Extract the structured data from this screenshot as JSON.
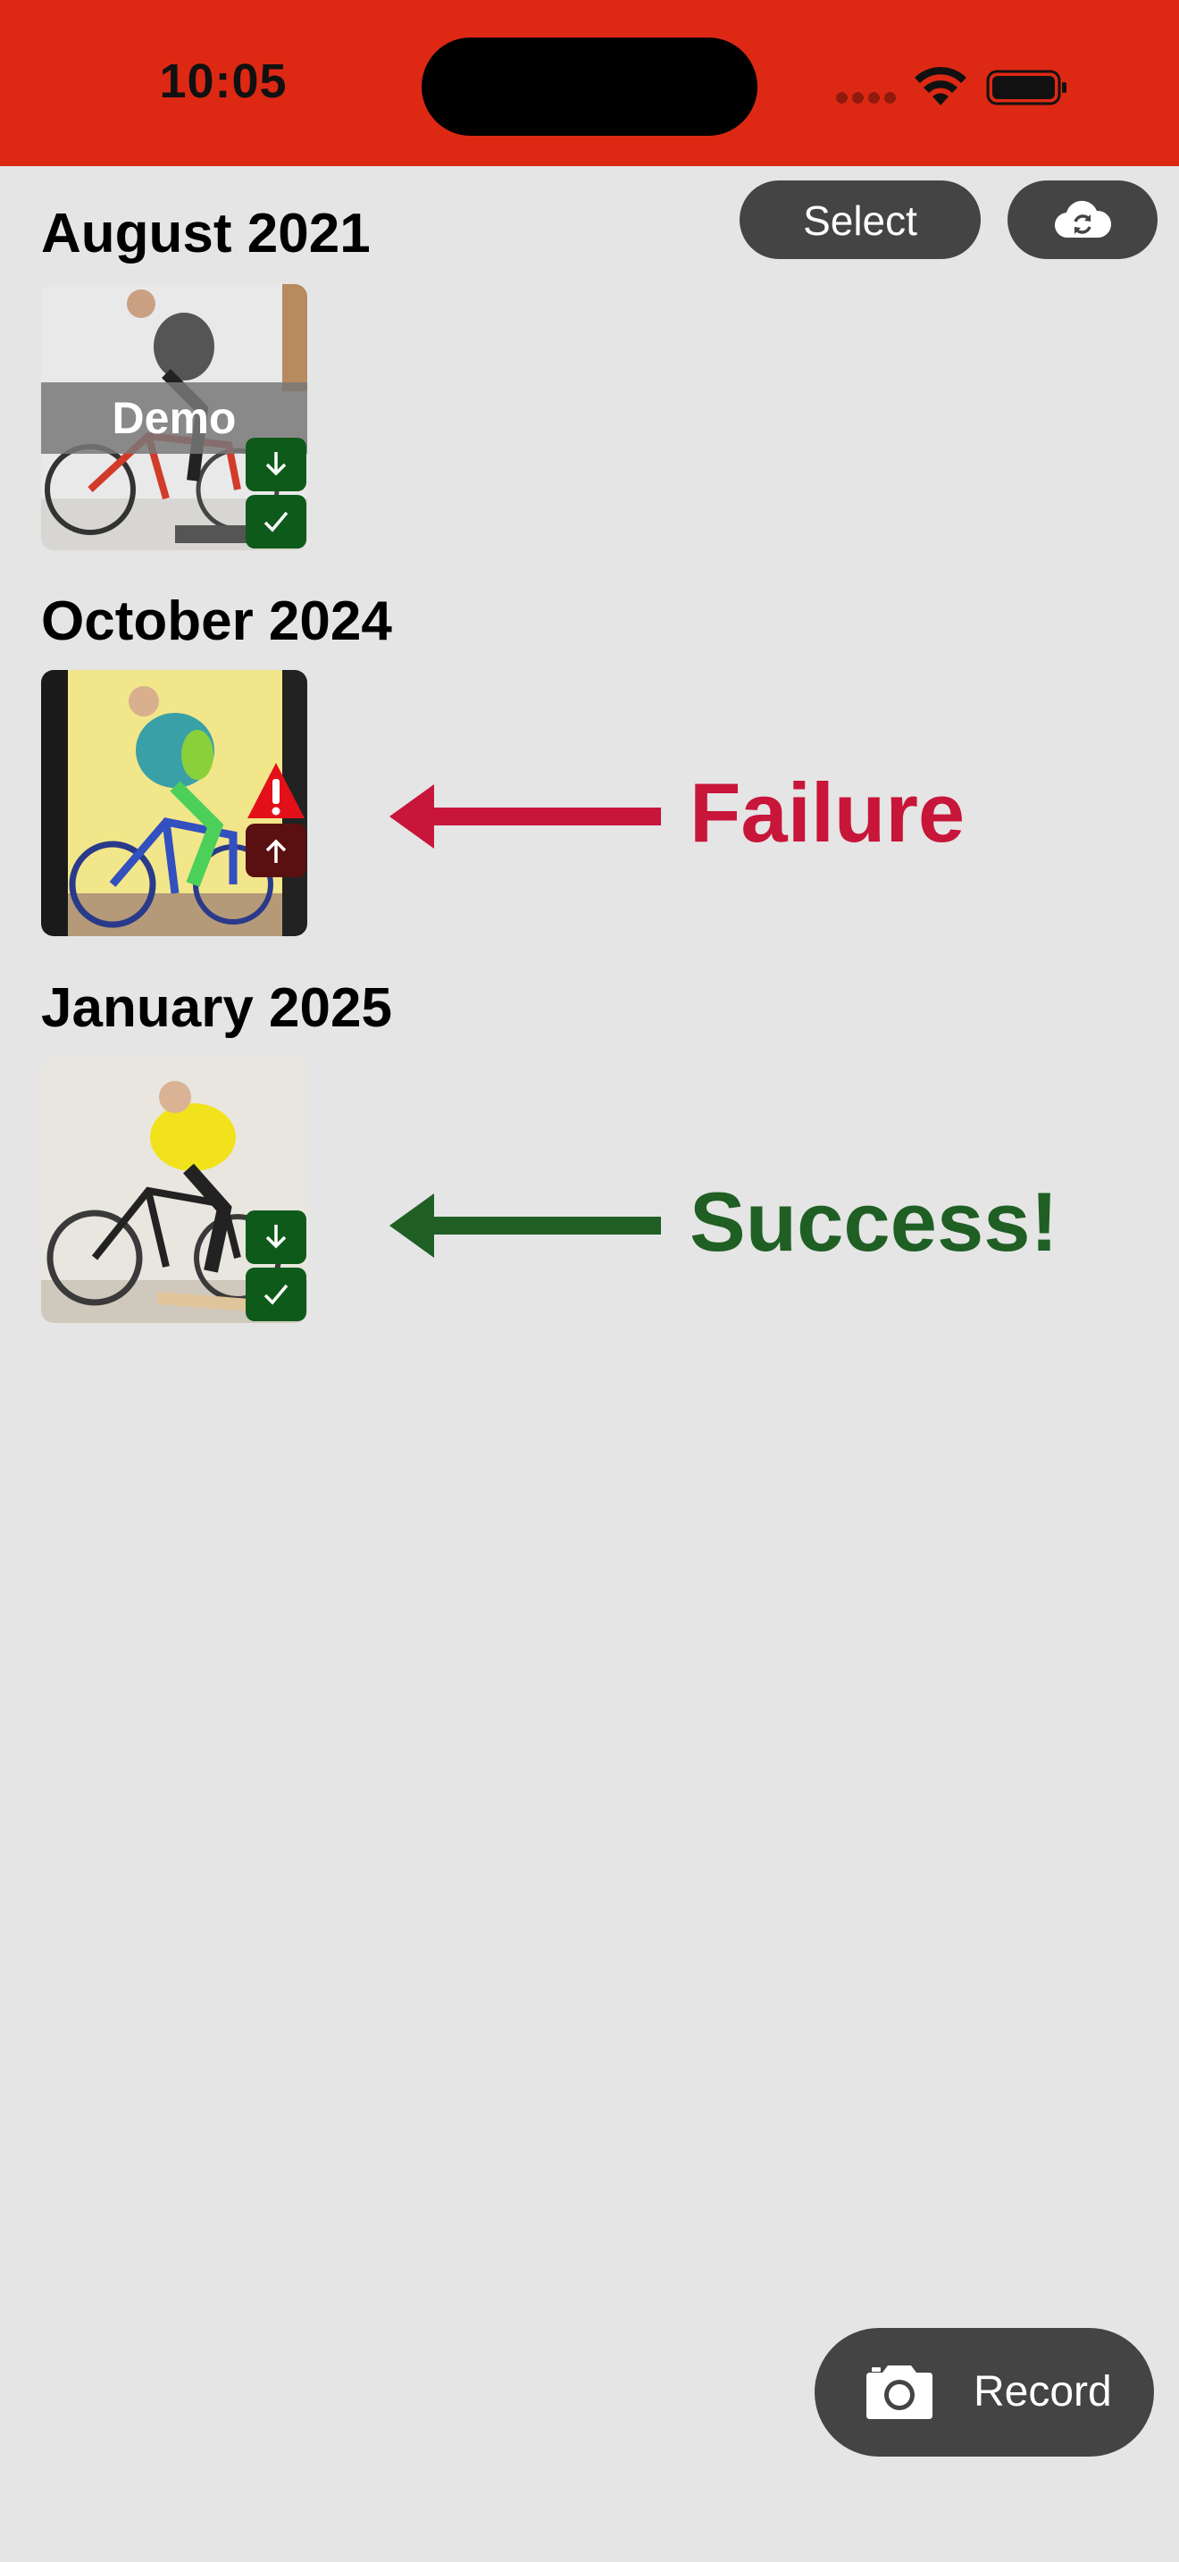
{
  "status_bar": {
    "time": "10:05",
    "background": "#dd2914"
  },
  "header": {
    "select_label": "Select",
    "cloud_sync_icon": "cloud-sync-icon"
  },
  "sections": [
    {
      "title": "August 2021",
      "videos": [
        {
          "overlay_label": "Demo",
          "badges": [
            "download-icon",
            "checkmark-icon"
          ]
        }
      ]
    },
    {
      "title": "October 2024",
      "videos": [
        {
          "badges": [
            "warning-icon",
            "upload-icon"
          ]
        }
      ]
    },
    {
      "title": "January 2025",
      "videos": [
        {
          "badges": [
            "download-icon",
            "checkmark-icon"
          ]
        }
      ]
    }
  ],
  "annotations": {
    "failure": {
      "label": "Failure",
      "color": "#c8153a"
    },
    "success": {
      "label": "Success!",
      "color": "#1f5f24"
    }
  },
  "record_button": {
    "label": "Record",
    "icon": "camera-icon"
  },
  "colors": {
    "background": "#e5e5e5",
    "button": "#444444",
    "badge_green": "#0e5a1a",
    "badge_red": "#5a1010"
  }
}
